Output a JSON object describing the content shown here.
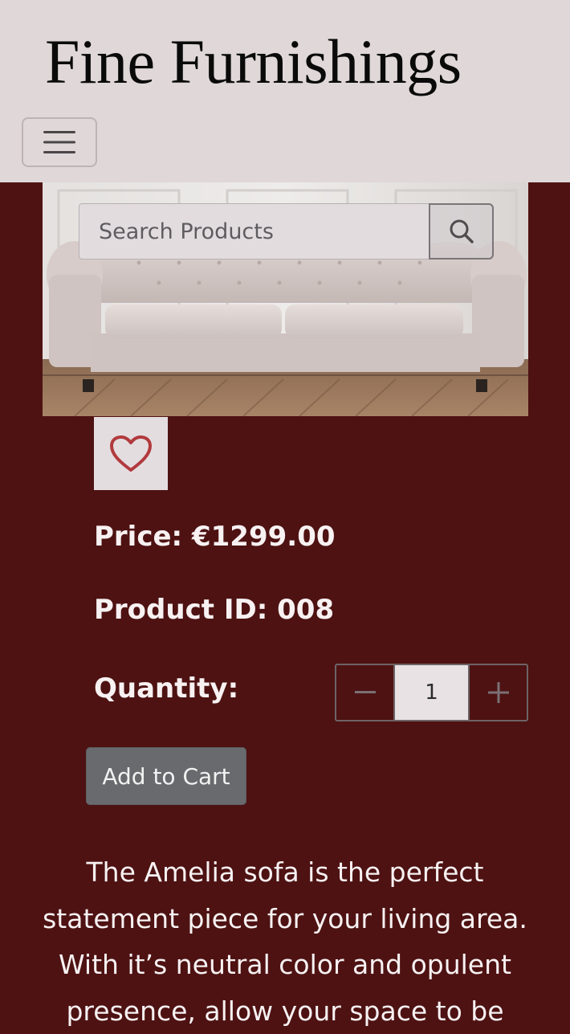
{
  "header": {
    "brand": "Fine Furnishings",
    "menu_icon": "hamburger-menu-icon"
  },
  "search": {
    "placeholder": "Search Products",
    "icon": "search-icon"
  },
  "product": {
    "image_alt": "Tufted chesterfield sofa in neutral fabric",
    "wishlist_icon": "heart-outline-icon",
    "price_text": "Price: €1299.00",
    "product_id_text": "Product ID: 008",
    "quantity_label": "Quantity:",
    "quantity_value": "1",
    "add_to_cart_label": "Add to Cart",
    "description": "The Amelia sofa is the perfect statement piece for your living area. With it’s neutral color and opulent presence, allow your space to be"
  },
  "colors": {
    "header_bg": "#dfd7d8",
    "page_bg": "#4e1212",
    "accent_heart": "#b13a3d",
    "button_gray": "#696a6e"
  }
}
